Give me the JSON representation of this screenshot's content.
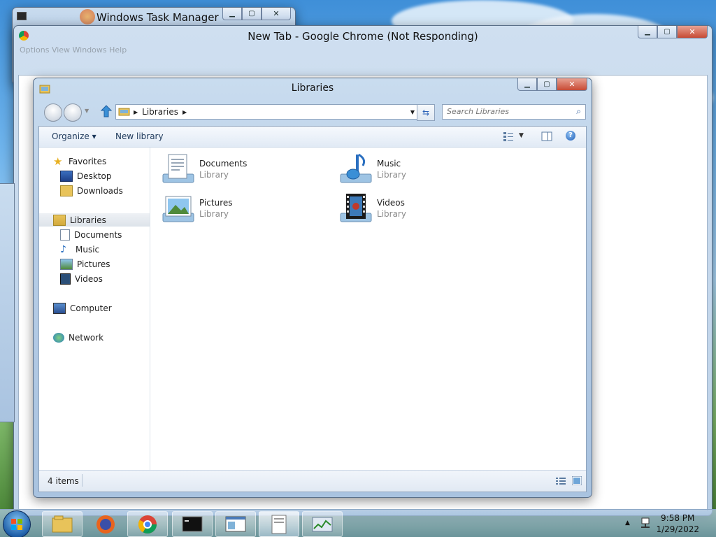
{
  "taskmgr": {
    "title": "Windows Task Manager"
  },
  "chrome": {
    "title": "New Tab - Google Chrome (Not Responding)",
    "blurred_menu": "Options   View   Windows   Help"
  },
  "explorer": {
    "title": "Libraries",
    "address": {
      "crumb": "Libraries"
    },
    "search": {
      "placeholder": "Search Libraries"
    },
    "toolbar": {
      "organize": "Organize ▾",
      "new_library": "New library"
    },
    "nav": {
      "favorites": "Favorites",
      "desktop": "Desktop",
      "downloads": "Downloads",
      "libraries": "Libraries",
      "documents": "Documents",
      "music": "Music",
      "pictures": "Pictures",
      "videos": "Videos",
      "computer": "Computer",
      "network": "Network"
    },
    "items": [
      {
        "name": "Documents",
        "sub": "Library"
      },
      {
        "name": "Music",
        "sub": "Library"
      },
      {
        "name": "Pictures",
        "sub": "Library"
      },
      {
        "name": "Videos",
        "sub": "Library"
      }
    ],
    "status": {
      "count": "4 items"
    }
  },
  "taskbar": {
    "clock": {
      "time": "9:58 PM",
      "date": "1/29/2022"
    }
  }
}
